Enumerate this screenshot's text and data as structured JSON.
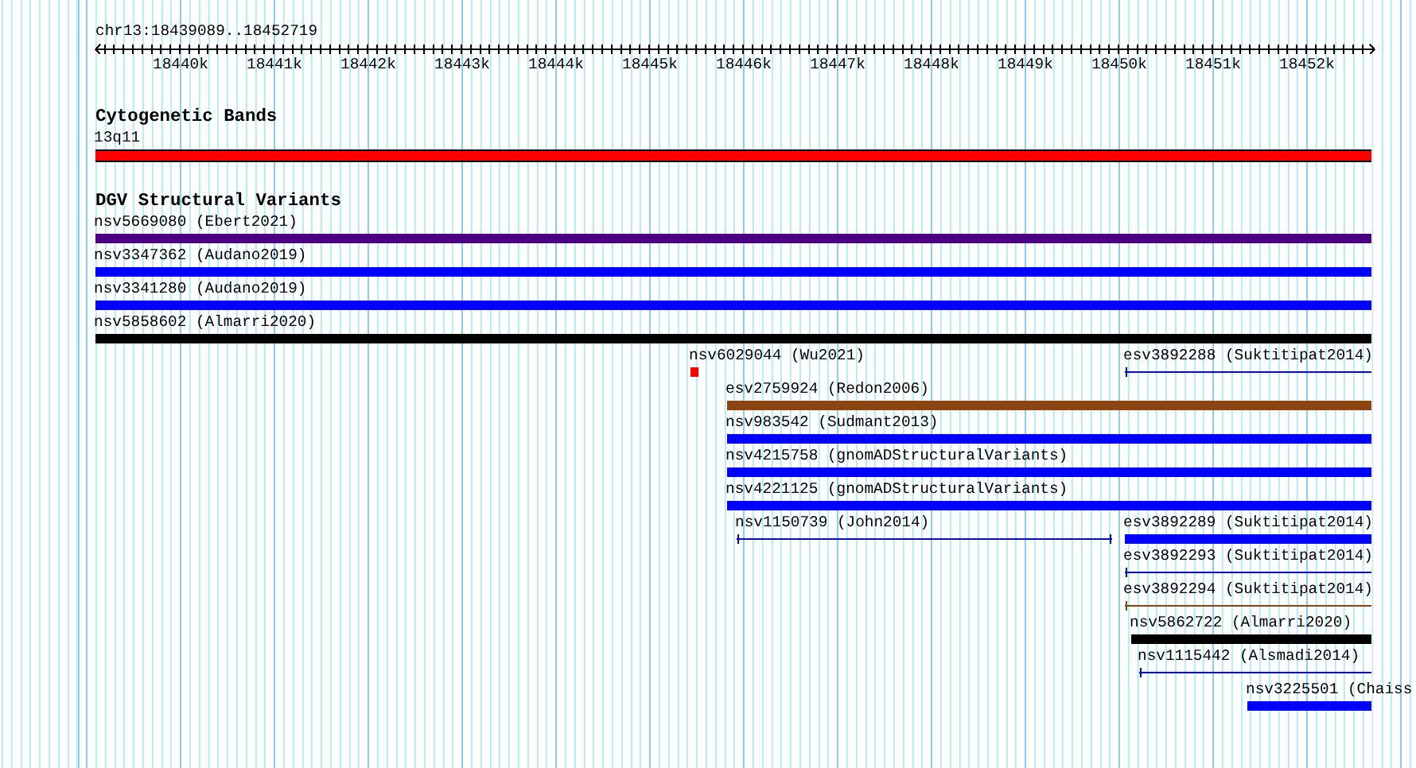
{
  "ruler": {
    "region": "chr13:18439089..18452719",
    "ticks": [
      "18440k",
      "18441k",
      "18442k",
      "18443k",
      "18444k",
      "18445k",
      "18446k",
      "18447k",
      "18448k",
      "18449k",
      "18450k",
      "18451k",
      "18452k"
    ]
  },
  "tracks": [
    {
      "title": "Cytogenetic Bands",
      "features": [
        {
          "label": "13q11",
          "kind": "band",
          "color": "#ff0000"
        }
      ]
    },
    {
      "title": "DGV Structural Variants",
      "features": [
        {
          "label": "nsv5669080 (Ebert2021)",
          "kind": "bar",
          "color": "#4b0082"
        },
        {
          "label": "nsv3347362 (Audano2019)",
          "kind": "bar",
          "color": "#0000ff"
        },
        {
          "label": "nsv3341280 (Audano2019)",
          "kind": "bar",
          "color": "#0000ff"
        },
        {
          "label": "nsv5858602 (Almarri2020)",
          "kind": "bar",
          "color": "#000000"
        },
        {
          "label": "nsv6029044 (Wu2021)",
          "kind": "bar",
          "color": "#ff0000"
        },
        {
          "label": "esv3892288 (Suktitipat2014)",
          "kind": "line",
          "color": "#0000ff"
        },
        {
          "label": "esv2759924 (Redon2006)",
          "kind": "bar",
          "color": "#8b4513"
        },
        {
          "label": "nsv983542 (Sudmant2013)",
          "kind": "bar",
          "color": "#0000ff"
        },
        {
          "label": "nsv4215758 (gnomADStructuralVariants)",
          "kind": "bar",
          "color": "#0000ff"
        },
        {
          "label": "nsv4221125 (gnomADStructuralVariants)",
          "kind": "bar",
          "color": "#0000ff"
        },
        {
          "label": "nsv1150739 (John2014)",
          "kind": "line",
          "color": "#0000ff"
        },
        {
          "label": "esv3892289 (Suktitipat2014)",
          "kind": "bar",
          "color": "#0000ff"
        },
        {
          "label": "esv3892293 (Suktitipat2014)",
          "kind": "line",
          "color": "#0000ff"
        },
        {
          "label": "esv3892294 (Suktitipat2014)",
          "kind": "line",
          "color": "#8b4513"
        },
        {
          "label": "nsv5862722 (Almarri2020)",
          "kind": "bar",
          "color": "#000000"
        },
        {
          "label": "nsv1115442 (Alsmadi2014)",
          "kind": "line",
          "color": "#0000ff"
        },
        {
          "label": "nsv3225501 (Chaiss",
          "kind": "bar",
          "color": "#0000ff"
        }
      ]
    }
  ]
}
